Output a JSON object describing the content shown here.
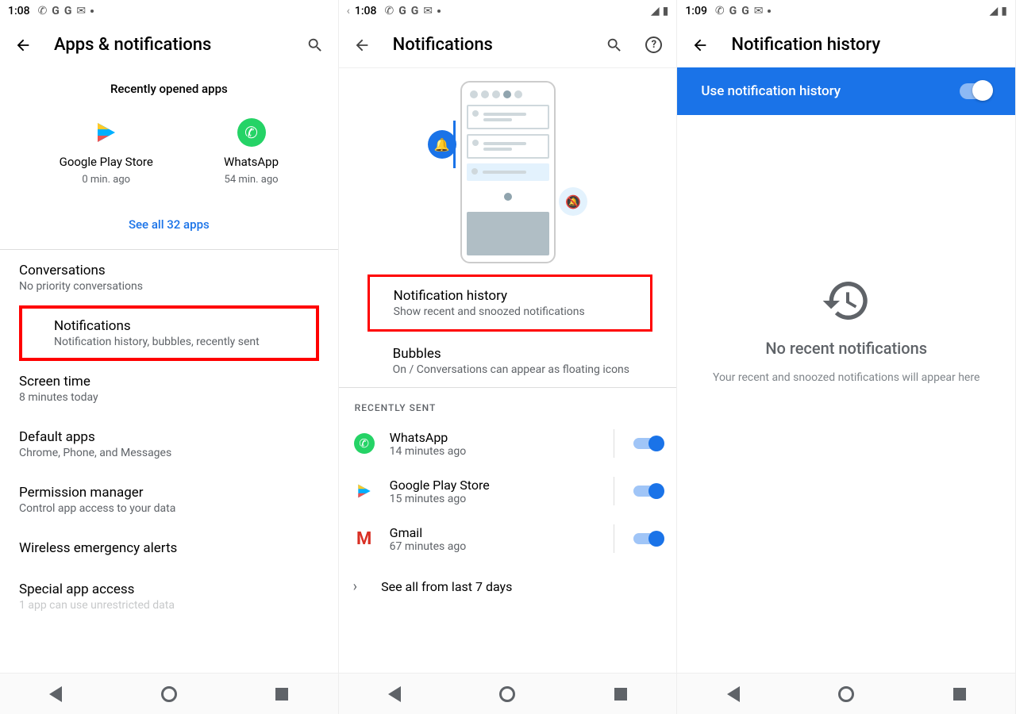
{
  "screen1": {
    "status": {
      "time": "1:08"
    },
    "title": "Apps & notifications",
    "recently_opened_label": "Recently opened apps",
    "apps": [
      {
        "name": "Google Play Store",
        "time": "0 min. ago"
      },
      {
        "name": "WhatsApp",
        "time": "54 min. ago"
      }
    ],
    "see_all": "See all 32 apps",
    "rows": [
      {
        "title": "Conversations",
        "sub": "No priority conversations"
      },
      {
        "title": "Notifications",
        "sub": "Notification history, bubbles, recently sent"
      },
      {
        "title": "Screen time",
        "sub": "8 minutes today"
      },
      {
        "title": "Default apps",
        "sub": "Chrome, Phone, and Messages"
      },
      {
        "title": "Permission manager",
        "sub": "Control app access to your data"
      },
      {
        "title": "Wireless emergency alerts",
        "sub": ""
      },
      {
        "title": "Special app access",
        "sub": "1 app can use unrestricted data"
      }
    ]
  },
  "screen2": {
    "status": {
      "time": "1:08"
    },
    "title": "Notifications",
    "history": {
      "title": "Notification history",
      "sub": "Show recent and snoozed notifications"
    },
    "bubbles": {
      "title": "Bubbles",
      "sub": "On / Conversations can appear as floating icons"
    },
    "recently_sent_label": "RECENTLY SENT",
    "sent": [
      {
        "name": "WhatsApp",
        "time": "14 minutes ago"
      },
      {
        "name": "Google Play Store",
        "time": "15 minutes ago"
      },
      {
        "name": "Gmail",
        "time": "67 minutes ago"
      }
    ],
    "see_all_7": "See all from last 7 days"
  },
  "screen3": {
    "status": {
      "time": "1:09"
    },
    "title": "Notification history",
    "toggle_label": "Use notification history",
    "empty_title": "No recent notifications",
    "empty_sub": "Your recent and snoozed notifications will appear here"
  }
}
